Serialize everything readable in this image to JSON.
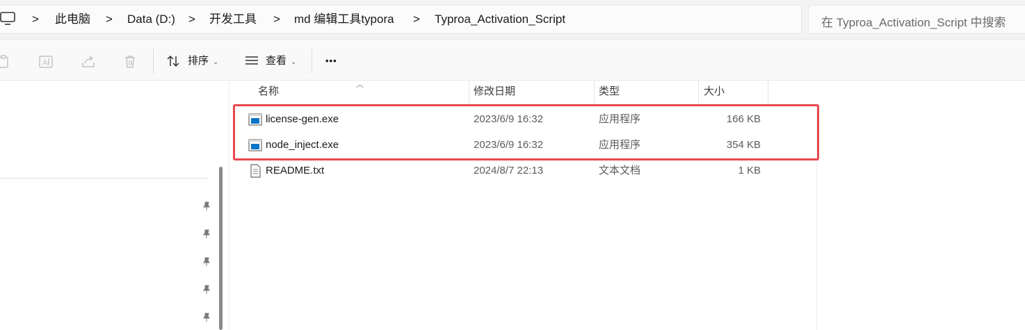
{
  "address_bar": {
    "crumbs": [
      "此电脑",
      "Data (D:)",
      "开发工具",
      "md 编辑工具typora",
      "Typroa_Activation_Script"
    ],
    "separator": ">"
  },
  "search": {
    "placeholder": "在 Typroa_Activation_Script 中搜索"
  },
  "toolbar": {
    "sort_label": "排序",
    "view_label": "查看",
    "more_label": "•••"
  },
  "columns": {
    "name": "名称",
    "date": "修改日期",
    "type": "类型",
    "size": "大小"
  },
  "files": [
    {
      "name": "license-gen.exe",
      "date": "2023/6/9 16:32",
      "type": "应用程序",
      "size": "166 KB",
      "icon": "exe-icon"
    },
    {
      "name": "node_inject.exe",
      "date": "2023/6/9 16:32",
      "type": "应用程序",
      "size": "354 KB",
      "icon": "exe-icon"
    },
    {
      "name": "README.txt",
      "date": "2024/8/7 22:13",
      "type": "文本文档",
      "size": "1 KB",
      "icon": "txt-file-icon"
    }
  ],
  "colors": {
    "highlight": "#e8484e",
    "accent": "#0067c0"
  }
}
